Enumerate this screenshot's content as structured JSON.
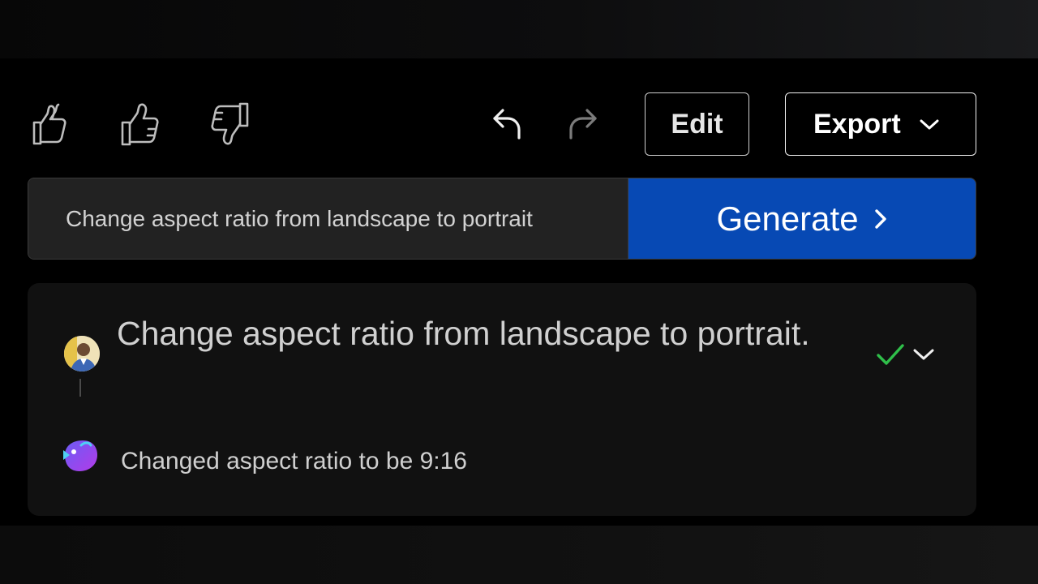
{
  "toolbar": {
    "icons": {
      "like_double": "double-thumbs-up-icon",
      "like": "thumbs-up-icon",
      "dislike": "thumbs-down-icon",
      "undo": "undo-icon",
      "redo": "redo-icon"
    },
    "edit_label": "Edit",
    "export_label": "Export"
  },
  "prompt": {
    "value": "Change aspect ratio from landscape to portrait",
    "generate_label": "Generate"
  },
  "history": {
    "user_message": "Change aspect ratio from landscape to portrait.",
    "bot_message": "Changed aspect ratio to be 9:16",
    "status": "check-icon"
  },
  "colors": {
    "accent": "#0749b4",
    "check": "#2fbf4a",
    "background": "#000000",
    "card": "#111111"
  }
}
